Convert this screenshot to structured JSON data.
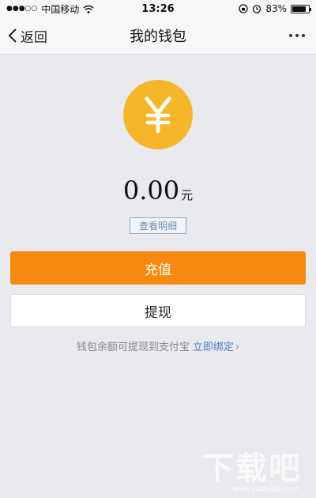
{
  "status_bar": {
    "carrier": "中国移动",
    "time": "13:26",
    "battery_percent": "83%",
    "battery_level": 0.83
  },
  "nav": {
    "back_label": "返回",
    "title": "我的钱包"
  },
  "wallet": {
    "currency_symbol": "¥",
    "amount": "0.00",
    "unit": "元",
    "detail_label": "查看明细",
    "recharge_label": "充值",
    "withdraw_label": "提现",
    "hint_text": "钱包余额可提现到支付宝",
    "bind_label": "立即绑定"
  },
  "watermark": {
    "text": "下载吧",
    "sub": "www.xiazaiba.com"
  },
  "colors": {
    "accent_orange": "#f68a10",
    "coin_yellow": "#f5b62a",
    "link_blue": "#4a7fbf",
    "background": "#e9e9ee"
  }
}
